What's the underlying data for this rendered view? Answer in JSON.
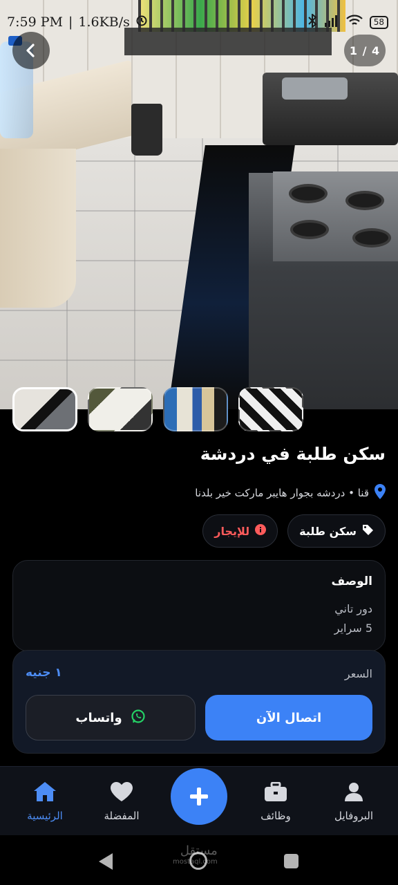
{
  "status_bar": {
    "time": "7:59 PM",
    "speed": "1.6KB/s",
    "battery": "58"
  },
  "gallery": {
    "counter": "1 / 4",
    "thumbnails": [
      "kitchen",
      "bedroom-floor",
      "hallway-bathroom",
      "bedroom"
    ]
  },
  "listing": {
    "title": "سكن طلبة في دردشة",
    "location": "قنا • دردشه بجوار هايبر ماركت خير بلدنا",
    "category_chip": "سكن طلبة",
    "status_chip": "للإيجار"
  },
  "description": {
    "heading": "الوصف",
    "lines": [
      "دور تاني",
      "5 سراير"
    ]
  },
  "price": {
    "label": "السعر",
    "value": "١ جنيه",
    "call_label": "اتصال الآن",
    "whatsapp_label": "واتساب"
  },
  "nav": {
    "profile": "البروفايل",
    "jobs": "وظائف",
    "favorites": "المفضلة",
    "home": "الرئيسية"
  },
  "watermark": {
    "text": "مستقل",
    "sub": "mostaql.com"
  },
  "colors": {
    "accent": "#3c82f6",
    "rent_status": "#ff5b5b",
    "whatsapp": "#25d366",
    "background": "#000000"
  }
}
